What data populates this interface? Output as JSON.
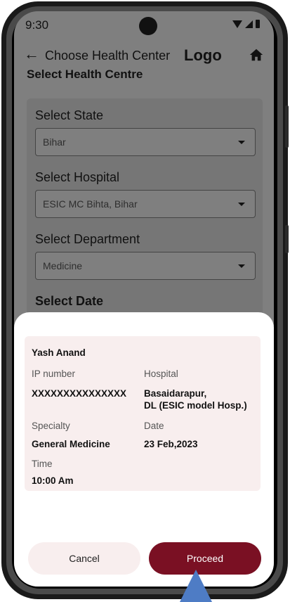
{
  "status_bar": {
    "time": "9:30"
  },
  "app_bar": {
    "title": "Choose Health Center",
    "logo": "Logo"
  },
  "section_title": "Select Health Centre",
  "form": {
    "state_label": "Select State",
    "state_value": "Bihar",
    "hospital_label": "Select Hospital",
    "hospital_value": "ESIC MC Bihta, Bihar",
    "department_label": "Select Department",
    "department_value": "Medicine",
    "date_label": "Select Date"
  },
  "summary": {
    "name": "Yash Anand",
    "ip_label": "IP number",
    "ip_value": "XXXXXXXXXXXXXXX",
    "hospital_label": "Hospital",
    "hospital_line1": "Basaidarapur,",
    "hospital_line2": "DL (ESIC model Hosp.)",
    "specialty_label": "Specialty",
    "specialty_value": "General Medicine",
    "date_label": "Date",
    "date_value": "23 Feb,2023",
    "time_label": "Time",
    "time_value": "10:00 Am"
  },
  "actions": {
    "cancel_label": "Cancel",
    "proceed_label": "Proceed"
  },
  "colors": {
    "primary": "#7a1023",
    "card_tint": "#f8eeee",
    "overlay": "#7f7f7f",
    "pointer": "#4e7cc5"
  },
  "icons": [
    "back-arrow-icon",
    "home-icon",
    "dropdown-icon",
    "wifi-icon",
    "signal-icon",
    "battery-icon"
  ]
}
